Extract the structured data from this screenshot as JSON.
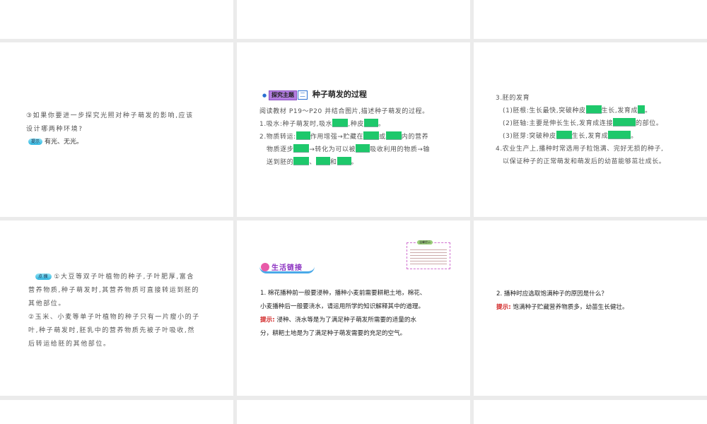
{
  "slides": {
    "s4": {
      "line1": "③如果你要进一步探究光照对种子萌发的影响,应该",
      "line2": "设计哪两种环境?",
      "hint_label": "提示",
      "hint_text": "有光、无光。"
    },
    "s5": {
      "tag": "探究主题",
      "tag_num": "二",
      "title": "种子萌发的过程",
      "intro": "阅读教材 P19～P20 并结合图片,描述种子萌发的过程。",
      "l1a": "1.吸水:种子萌发时,吸水",
      "l1b": ",种皮",
      "l1c": "。",
      "l2a": "2.物质转运:",
      "l2b": "作用增强→贮藏在",
      "l2c": "或",
      "l2d": "内的营养",
      "l3a": "物质逐步",
      "l3b": "→转化为可以被",
      "l3c": "吸收利用的物质→输",
      "l4a": "送到胚的",
      "l4b": "、",
      "l4c": "和",
      "l4d": "。"
    },
    "s6": {
      "l1": "3.胚的发育",
      "l2a": "(1)胚根:生长最快,突破种皮",
      "l2b": "生长,发育成",
      "l2c": "。",
      "l3a": "(2)胚轴:主要是伸长生长,发育成连接",
      "l3b": "的部位。",
      "l4a": "(3)胚芽:突破种皮",
      "l4b": "生长,发育成",
      "l4c": "。",
      "l5": "4.农业生产上,播种时常选用子粒饱满、完好无损的种子,",
      "l6": "以保证种子的正常萌发和萌发后的幼苗能够茁壮成长。"
    },
    "s7": {
      "label": "点拨",
      "l1": "①大豆等双子叶植物的种子,子叶肥厚,富含",
      "l2": "营养物质,种子萌发时,其营养物质可直接转运到胚的",
      "l3": "其他部位。",
      "l4": "②玉米、小麦等单子叶植物的种子只有一片瘦小的子",
      "l5": "叶,种子萌发时,胚乳中的营养物质先被子叶吸收,然",
      "l6": "后转运给胚的其他部位。"
    },
    "s8": {
      "banner": "生活链接",
      "note_title": "温馨提示",
      "q1": "1. 棉花播种前一般要浸种，播种小麦前需要耕耙土地，棉花、",
      "q2": "小麦播种后一般要浇水，请运用所学的知识解释其中的道理。",
      "hint_label": "提示:",
      "a1": "浸种、浇水等是为了满足种子萌发所需要的适量的水",
      "a2": "分，耕耙土地是为了满足种子萌发需要的充足的空气。"
    },
    "s9": {
      "q": "2. 播种时应选取饱满种子的原因是什么？",
      "hint_label": "提示:",
      "a": "饱满种子贮藏营养物质多，幼苗生长健壮。"
    }
  },
  "colors": {
    "blank": "#1ec86b",
    "gap": "#ebebeb",
    "hint_red": "#d02020"
  }
}
